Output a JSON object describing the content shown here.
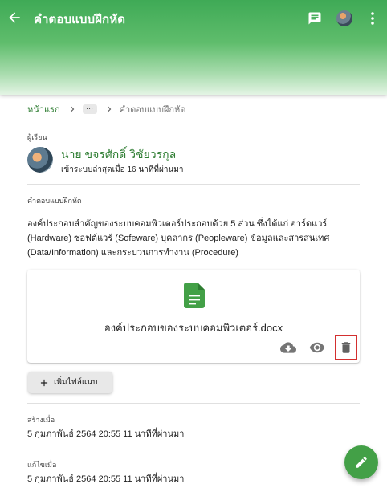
{
  "header": {
    "title": "คำตอบแบบฝึกหัด",
    "back_icon": "arrow-back-icon",
    "chat_icon": "chat-icon",
    "more_icon": "more-vert-icon"
  },
  "breadcrumb": {
    "home": "หน้าแรก",
    "ellipsis": "···",
    "current": "คำตอบแบบฝึกหัด"
  },
  "student": {
    "label": "ผู้เรียน",
    "name": "นาย ขจรศักดิ์ วิชัยวรกุล",
    "last_login": "เข้าระบบล่าสุดเมื่อ 16 นาทีที่ผ่านมา"
  },
  "answer": {
    "label": "คำตอบแบบฝึกหัด",
    "text": "องค์ประกอบสำคัญของระบบคอมพิวเตอร์ประกอบด้วย 5 ส่วน ซึ่งได้แก่ ฮาร์ดแวร์ (Hardware) ซอฟต์แวร์ (Sofeware) บุคลากร (Peopleware) ข้อมูลและสารสนเทศ (Data/Information) และกระบวนการทำงาน (Procedure)"
  },
  "attachment": {
    "file_name": "องค์ประกอบของระบบคอมพิวเตอร์.docx",
    "file_icon": "document-icon",
    "actions": [
      "download-icon",
      "view-icon",
      "delete-icon"
    ]
  },
  "add_file_button": "เพิ่มไฟล์แนบ",
  "created": {
    "label": "สร้างเมื่อ",
    "value": "5 กุมภาพันธ์ 2564 20:55 11 นาทีที่ผ่านมา"
  },
  "modified": {
    "label": "แก้ไขเมื่อ",
    "value": "5 กุมภาพันธ์ 2564 20:55 11 นาทีที่ผ่านมา"
  },
  "colors": {
    "primary": "#43a047",
    "accent_text": "#2e7d32",
    "highlight_border": "#d32f2f"
  }
}
